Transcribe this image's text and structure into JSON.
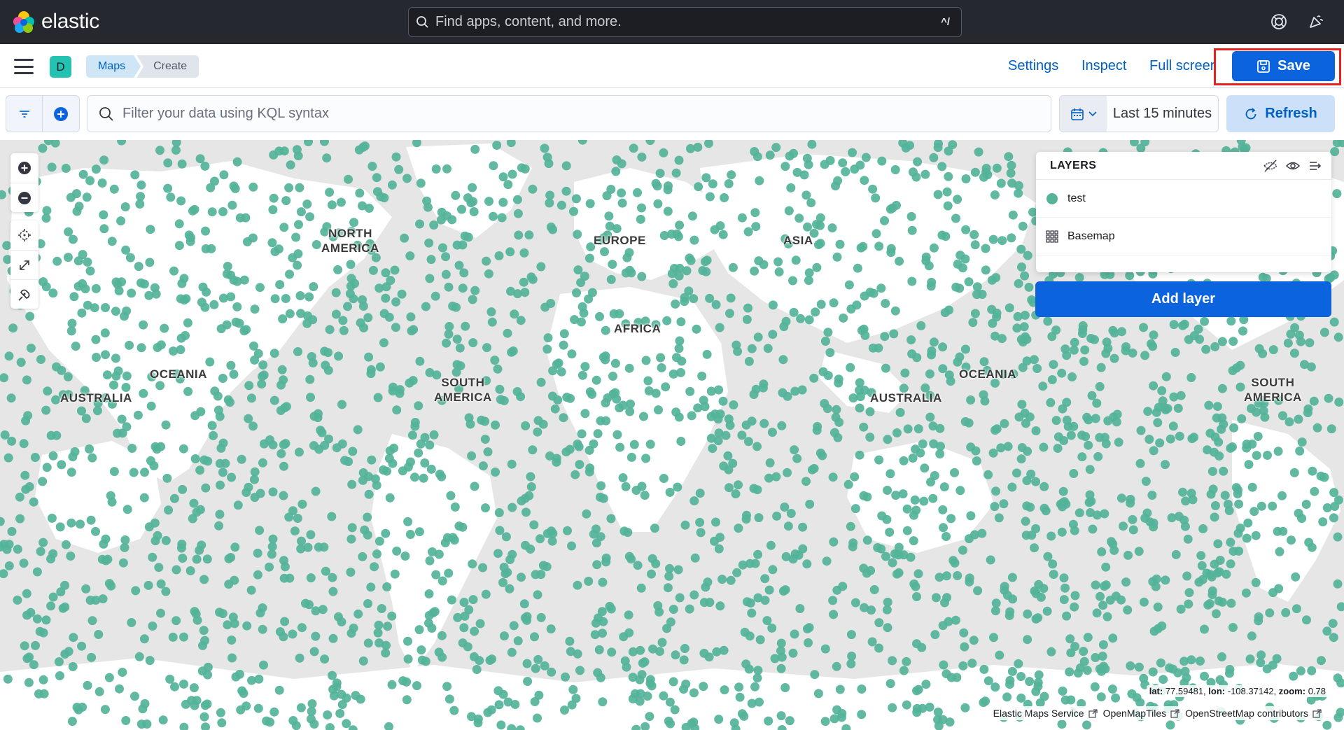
{
  "header": {
    "brand": "elastic",
    "search_placeholder": "Find apps, content, and more.",
    "search_shortcut": "^/",
    "icons": [
      "help-icon",
      "newsfeed-icon"
    ]
  },
  "appbar": {
    "space_initial": "D",
    "breadcrumbs": [
      "Maps",
      "Create"
    ],
    "links": {
      "settings": "Settings",
      "inspect": "Inspect",
      "fullscreen": "Full screer"
    },
    "save_label": "Save"
  },
  "query": {
    "kql_placeholder": "Filter your data using KQL syntax",
    "time_range": "Last 15 minutes",
    "refresh_label": "Refresh"
  },
  "map": {
    "continent_labels": {
      "north_america": "NORTH\nAMERICA",
      "europe": "EUROPE",
      "asia": "ASIA",
      "africa": "AFRICA",
      "oceania_left": "OCEANIA",
      "australia_left": "AUSTRALIA",
      "south_america": "SOUTH\nAMERICA",
      "oceania_right": "OCEANIA",
      "australia_right": "AUSTRALIA",
      "south_america_right": "SOUTH\nAMERICA"
    },
    "point_color": "#54b399",
    "coords": {
      "lat_label": "lat:",
      "lat": "77.59481,",
      "lon_label": "lon:",
      "lon": "-108.37142,",
      "zoom_label": "zoom:",
      "zoom": "0.78"
    },
    "attribution": [
      "Elastic Maps Service",
      "OpenMapTiles",
      "OpenStreetMap contributors"
    ]
  },
  "layers": {
    "title": "LAYERS",
    "items": [
      {
        "name": "test",
        "icon": "circle-dot-icon"
      },
      {
        "name": "Basemap",
        "icon": "grid-icon"
      }
    ],
    "add_label": "Add layer"
  },
  "colors": {
    "header_bg": "#25282f",
    "primary": "#0b64dd",
    "link": "#0061c2",
    "highlight": "#e2231f"
  }
}
